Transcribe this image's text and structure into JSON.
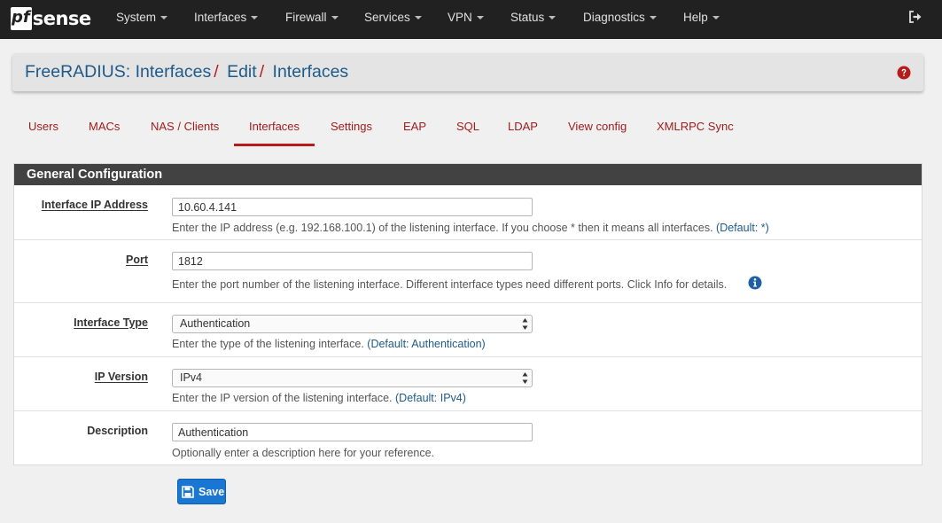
{
  "brand": {
    "logo_pf": "pf",
    "logo_sense": "sense"
  },
  "nav": {
    "items": [
      {
        "label": "System"
      },
      {
        "label": "Interfaces"
      },
      {
        "label": "Firewall"
      },
      {
        "label": "Services"
      },
      {
        "label": "VPN"
      },
      {
        "label": "Status"
      },
      {
        "label": "Diagnostics"
      },
      {
        "label": "Help"
      }
    ],
    "logout_icon": "sign-out-icon"
  },
  "breadcrumb": {
    "part1": "FreeRADIUS: Interfaces",
    "part2": "Edit",
    "part3": "Interfaces",
    "separator": "/",
    "help_icon": "question-circle-icon"
  },
  "tabs": [
    {
      "label": "Users"
    },
    {
      "label": "MACs"
    },
    {
      "label": "NAS / Clients"
    },
    {
      "label": "Interfaces",
      "active": true
    },
    {
      "label": "Settings"
    },
    {
      "label": "EAP"
    },
    {
      "label": "SQL"
    },
    {
      "label": "LDAP"
    },
    {
      "label": "View config"
    },
    {
      "label": "XMLRPC Sync"
    }
  ],
  "panel": {
    "title": "General Configuration",
    "fields": {
      "ip_address": {
        "label": "Interface IP Address",
        "value": "10.60.4.141",
        "help": "Enter the IP address (e.g. 192.168.100.1) of the listening interface. If you choose * then it means all interfaces.",
        "default": "(Default: *)"
      },
      "port": {
        "label": "Port",
        "value": "1812",
        "help": "Enter the port number of the listening interface. Different interface types need different ports. Click Info for details.",
        "info_icon": "info-circle-icon"
      },
      "interface_type": {
        "label": "Interface Type",
        "value": "Authentication",
        "help": "Enter the type of the listening interface.",
        "default": "(Default: Authentication)"
      },
      "ip_version": {
        "label": "IP Version",
        "value": "IPv4",
        "help": "Enter the IP version of the listening interface.",
        "default": "(Default: IPv4)"
      },
      "description": {
        "label": "Description",
        "value": "Authentication",
        "help": "Optionally enter a description here for your reference."
      }
    }
  },
  "save_button": {
    "label": "Save",
    "icon": "floppy-disk-icon"
  },
  "colors": {
    "navbar_bg": "#212121",
    "link_blue": "#1e5a8a",
    "tab_red": "#a11c1c",
    "panel_head_bg": "#424242",
    "button_blue": "#1976d2"
  }
}
